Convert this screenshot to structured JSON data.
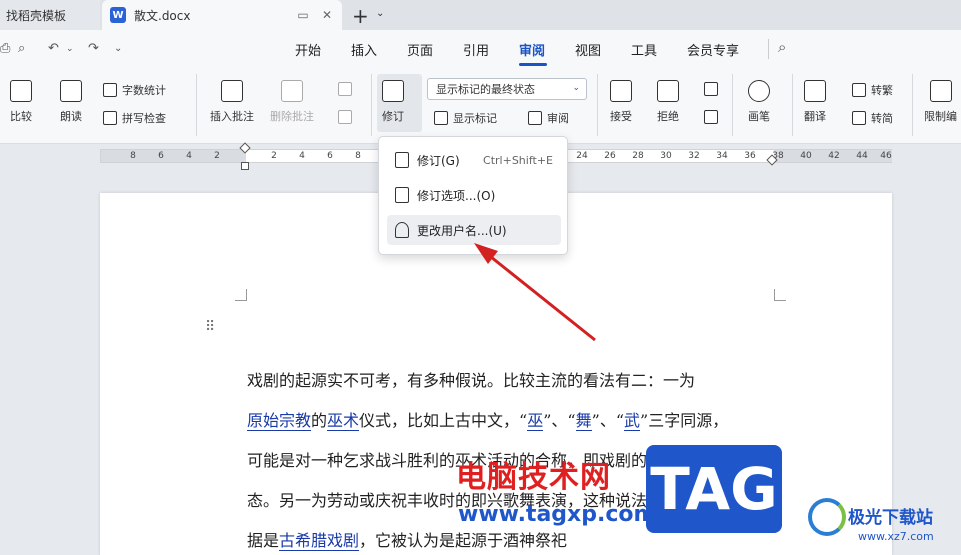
{
  "tabs": {
    "templates_label": "找稻壳模板",
    "doc_badge": "W",
    "doc_label": "散文.docx",
    "new_tab": "+",
    "new_tab_menu": "⌄"
  },
  "menu": {
    "items": [
      "开始",
      "插入",
      "页面",
      "引用",
      "审阅",
      "视图",
      "工具",
      "会员专享"
    ],
    "active": "审阅"
  },
  "ribbon": {
    "compare": "比较",
    "read_aloud": "朗读",
    "word_count": "字数统计",
    "spell_check": "拼写检查",
    "insert_comment": "插入批注",
    "delete_comment": "删除批注",
    "track_changes": "修订",
    "markup_select": "显示标记的最终状态",
    "show_markup": "显示标记",
    "review": "审阅",
    "accept": "接受",
    "reject": "拒绝",
    "pen": "画笔",
    "translate": "翻译",
    "to_traditional": "转繁",
    "to_simplified": "转简",
    "restrict_editing": "限制编"
  },
  "ruler": {
    "ticks_left": [
      "8",
      "6",
      "4",
      "2"
    ],
    "ticks_right": [
      "2",
      "4",
      "6",
      "8",
      "24",
      "26",
      "28",
      "30",
      "32",
      "34",
      "36",
      "38",
      "40",
      "42",
      "44",
      "46"
    ]
  },
  "dropdown": {
    "items": [
      {
        "label": "修订(G)",
        "shortcut": "Ctrl+Shift+E"
      },
      {
        "label": "修订选项...(O)",
        "shortcut": ""
      },
      {
        "label": "更改用户名...(U)",
        "shortcut": ""
      }
    ]
  },
  "document": {
    "line1": "戏剧的起源实不可考，有多种假说。比较主流的看法有二：一为",
    "line2_link1": "原始宗教",
    "line2_t1": "的",
    "line2_link2": "巫术",
    "line2_t2": "仪式，比如上古中文，“",
    "line2_link3": "巫",
    "line2_t3": "”、“",
    "line2_link4": "舞",
    "line2_t4": "”、“",
    "line2_link5": "武",
    "line2_t5": "”三字同源，",
    "line3": "可能是对一种乞求战斗胜利的巫术活动的合称，即戏剧的原始形",
    "line4": "态。另一为劳动或庆祝丰收时的即兴歌舞表演，这种说法主要依",
    "line5_t1": "据是",
    "line5_link": "古希腊戏剧",
    "line5_t2": "，它被认为是起源于酒神祭祀"
  },
  "watermark": {
    "cn": "电脑技术网",
    "url": "www.tagxp.com",
    "tag": "TAG",
    "site": "极光下载站",
    "site_url": "www.xz7.com"
  }
}
